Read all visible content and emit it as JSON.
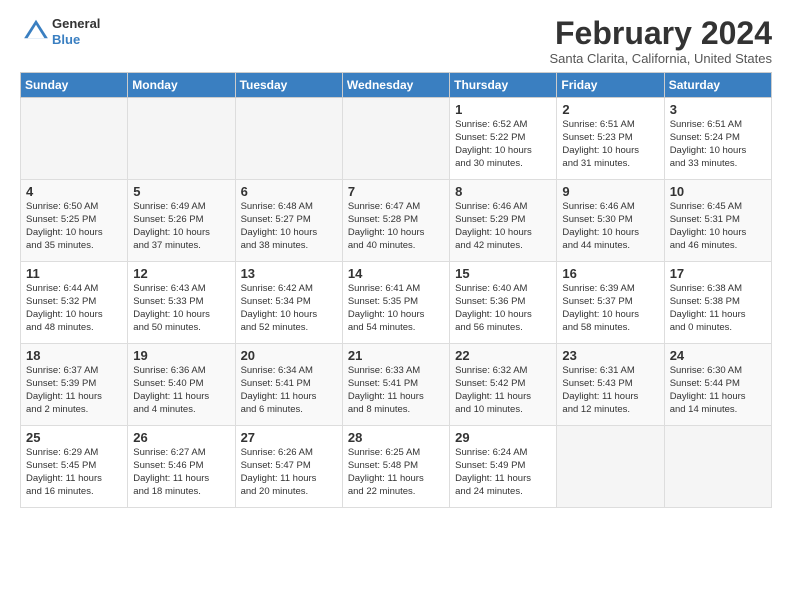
{
  "header": {
    "logo": {
      "general": "General",
      "blue": "Blue"
    },
    "title": "February 2024",
    "location": "Santa Clarita, California, United States"
  },
  "weekdays": [
    "Sunday",
    "Monday",
    "Tuesday",
    "Wednesday",
    "Thursday",
    "Friday",
    "Saturday"
  ],
  "weeks": [
    [
      {
        "day": "",
        "info": ""
      },
      {
        "day": "",
        "info": ""
      },
      {
        "day": "",
        "info": ""
      },
      {
        "day": "",
        "info": ""
      },
      {
        "day": "1",
        "info": "Sunrise: 6:52 AM\nSunset: 5:22 PM\nDaylight: 10 hours\nand 30 minutes."
      },
      {
        "day": "2",
        "info": "Sunrise: 6:51 AM\nSunset: 5:23 PM\nDaylight: 10 hours\nand 31 minutes."
      },
      {
        "day": "3",
        "info": "Sunrise: 6:51 AM\nSunset: 5:24 PM\nDaylight: 10 hours\nand 33 minutes."
      }
    ],
    [
      {
        "day": "4",
        "info": "Sunrise: 6:50 AM\nSunset: 5:25 PM\nDaylight: 10 hours\nand 35 minutes."
      },
      {
        "day": "5",
        "info": "Sunrise: 6:49 AM\nSunset: 5:26 PM\nDaylight: 10 hours\nand 37 minutes."
      },
      {
        "day": "6",
        "info": "Sunrise: 6:48 AM\nSunset: 5:27 PM\nDaylight: 10 hours\nand 38 minutes."
      },
      {
        "day": "7",
        "info": "Sunrise: 6:47 AM\nSunset: 5:28 PM\nDaylight: 10 hours\nand 40 minutes."
      },
      {
        "day": "8",
        "info": "Sunrise: 6:46 AM\nSunset: 5:29 PM\nDaylight: 10 hours\nand 42 minutes."
      },
      {
        "day": "9",
        "info": "Sunrise: 6:46 AM\nSunset: 5:30 PM\nDaylight: 10 hours\nand 44 minutes."
      },
      {
        "day": "10",
        "info": "Sunrise: 6:45 AM\nSunset: 5:31 PM\nDaylight: 10 hours\nand 46 minutes."
      }
    ],
    [
      {
        "day": "11",
        "info": "Sunrise: 6:44 AM\nSunset: 5:32 PM\nDaylight: 10 hours\nand 48 minutes."
      },
      {
        "day": "12",
        "info": "Sunrise: 6:43 AM\nSunset: 5:33 PM\nDaylight: 10 hours\nand 50 minutes."
      },
      {
        "day": "13",
        "info": "Sunrise: 6:42 AM\nSunset: 5:34 PM\nDaylight: 10 hours\nand 52 minutes."
      },
      {
        "day": "14",
        "info": "Sunrise: 6:41 AM\nSunset: 5:35 PM\nDaylight: 10 hours\nand 54 minutes."
      },
      {
        "day": "15",
        "info": "Sunrise: 6:40 AM\nSunset: 5:36 PM\nDaylight: 10 hours\nand 56 minutes."
      },
      {
        "day": "16",
        "info": "Sunrise: 6:39 AM\nSunset: 5:37 PM\nDaylight: 10 hours\nand 58 minutes."
      },
      {
        "day": "17",
        "info": "Sunrise: 6:38 AM\nSunset: 5:38 PM\nDaylight: 11 hours\nand 0 minutes."
      }
    ],
    [
      {
        "day": "18",
        "info": "Sunrise: 6:37 AM\nSunset: 5:39 PM\nDaylight: 11 hours\nand 2 minutes."
      },
      {
        "day": "19",
        "info": "Sunrise: 6:36 AM\nSunset: 5:40 PM\nDaylight: 11 hours\nand 4 minutes."
      },
      {
        "day": "20",
        "info": "Sunrise: 6:34 AM\nSunset: 5:41 PM\nDaylight: 11 hours\nand 6 minutes."
      },
      {
        "day": "21",
        "info": "Sunrise: 6:33 AM\nSunset: 5:41 PM\nDaylight: 11 hours\nand 8 minutes."
      },
      {
        "day": "22",
        "info": "Sunrise: 6:32 AM\nSunset: 5:42 PM\nDaylight: 11 hours\nand 10 minutes."
      },
      {
        "day": "23",
        "info": "Sunrise: 6:31 AM\nSunset: 5:43 PM\nDaylight: 11 hours\nand 12 minutes."
      },
      {
        "day": "24",
        "info": "Sunrise: 6:30 AM\nSunset: 5:44 PM\nDaylight: 11 hours\nand 14 minutes."
      }
    ],
    [
      {
        "day": "25",
        "info": "Sunrise: 6:29 AM\nSunset: 5:45 PM\nDaylight: 11 hours\nand 16 minutes."
      },
      {
        "day": "26",
        "info": "Sunrise: 6:27 AM\nSunset: 5:46 PM\nDaylight: 11 hours\nand 18 minutes."
      },
      {
        "day": "27",
        "info": "Sunrise: 6:26 AM\nSunset: 5:47 PM\nDaylight: 11 hours\nand 20 minutes."
      },
      {
        "day": "28",
        "info": "Sunrise: 6:25 AM\nSunset: 5:48 PM\nDaylight: 11 hours\nand 22 minutes."
      },
      {
        "day": "29",
        "info": "Sunrise: 6:24 AM\nSunset: 5:49 PM\nDaylight: 11 hours\nand 24 minutes."
      },
      {
        "day": "",
        "info": ""
      },
      {
        "day": "",
        "info": ""
      }
    ]
  ]
}
